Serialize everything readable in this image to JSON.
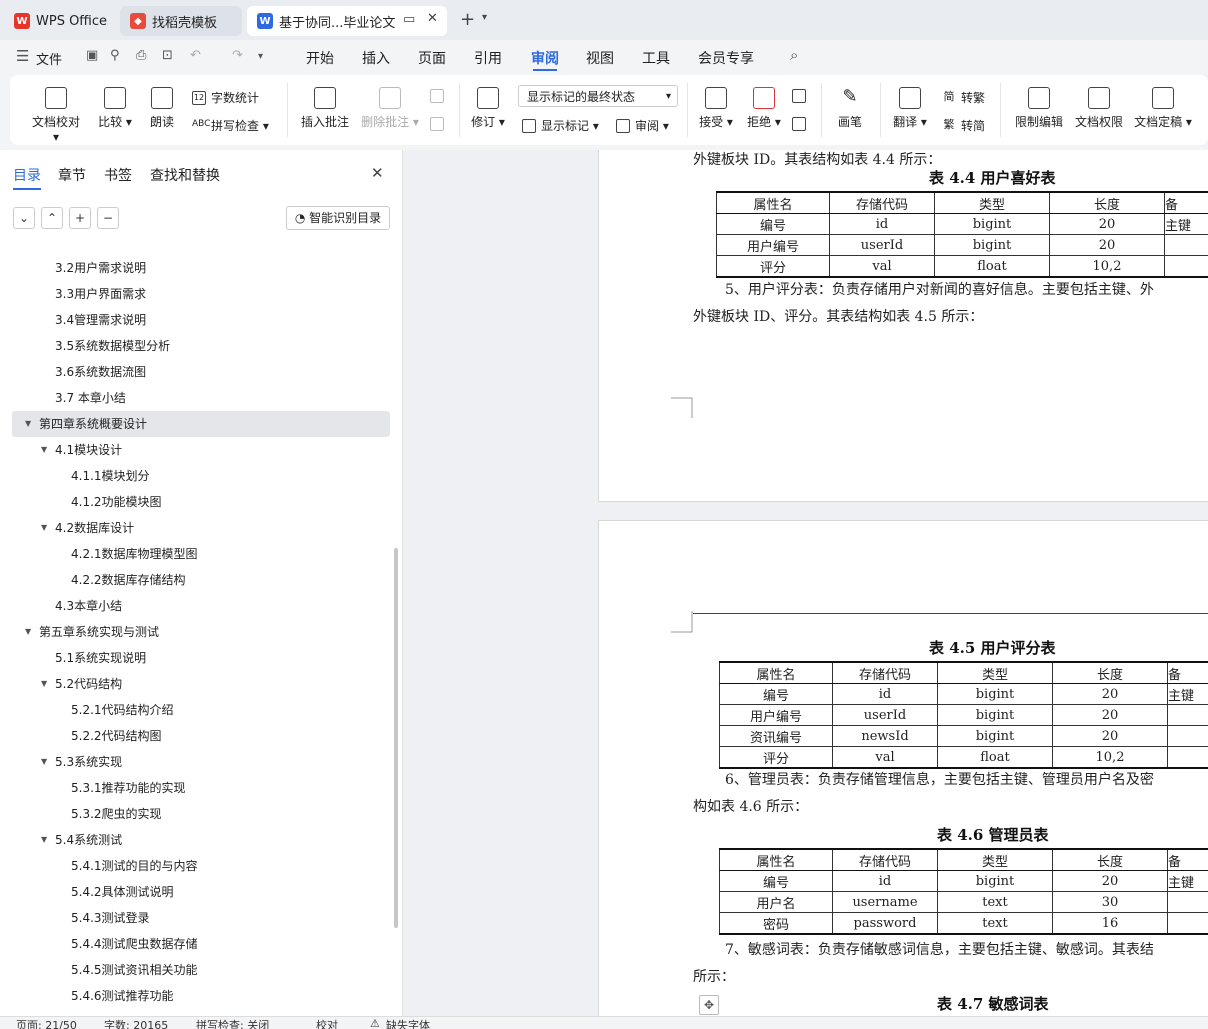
{
  "tabs": [
    {
      "label": "WPS Office"
    },
    {
      "label": "找稻壳模板"
    },
    {
      "label": "基于协同...毕业论文"
    }
  ],
  "menu": {
    "file": "文件",
    "items": [
      "开始",
      "插入",
      "页面",
      "引用",
      "审阅",
      "视图",
      "工具",
      "会员专享"
    ],
    "active": "审阅"
  },
  "ribbon": {
    "doc_check": "文档校对",
    "compare": "比较",
    "read_aloud": "朗读",
    "word_count": "字数统计",
    "spell_check": "拼写检查",
    "insert_comment": "插入批注",
    "delete_comment": "删除批注",
    "track_changes": "修订",
    "markup_state": "显示标记的最终状态",
    "show_markup": "显示标记",
    "review": "审阅",
    "accept": "接受",
    "reject": "拒绝",
    "pen": "画笔",
    "translate": "翻译",
    "to_traditional": "转繁",
    "to_simplified": "转简",
    "restrict_edit": "限制编辑",
    "doc_permission": "文档权限",
    "doc_finalize": "文档定稿"
  },
  "nav": {
    "tabs": [
      "目录",
      "章节",
      "书签",
      "查找和替换"
    ],
    "smart_toc": "智能识别目录",
    "toc": [
      {
        "text": "3.2用户需求说明",
        "level": 2
      },
      {
        "text": "3.3用户界面需求",
        "level": 2
      },
      {
        "text": "3.4管理需求说明",
        "level": 2
      },
      {
        "text": "3.5系统数据模型分析",
        "level": 2
      },
      {
        "text": "3.6系统数据流图",
        "level": 2
      },
      {
        "text": "3.7  本章小结",
        "level": 2
      },
      {
        "text": "第四章系统概要设计",
        "level": 1
      },
      {
        "text": "4.1模块设计",
        "level": 2
      },
      {
        "text": "4.1.1模块划分",
        "level": 3
      },
      {
        "text": "4.1.2功能模块图",
        "level": 3
      },
      {
        "text": "4.2数据库设计",
        "level": 2
      },
      {
        "text": "4.2.1数据库物理模型图",
        "level": 3
      },
      {
        "text": "4.2.2数据库存储结构",
        "level": 3
      },
      {
        "text": "4.3本章小结",
        "level": 2
      },
      {
        "text": "第五章系统实现与测试",
        "level": 1
      },
      {
        "text": "5.1系统实现说明",
        "level": 2
      },
      {
        "text": "5.2代码结构",
        "level": 2
      },
      {
        "text": "5.2.1代码结构介绍",
        "level": 3
      },
      {
        "text": "5.2.2代码结构图",
        "level": 3
      },
      {
        "text": "5.3系统实现",
        "level": 2
      },
      {
        "text": "5.3.1推荐功能的实现",
        "level": 3
      },
      {
        "text": "5.3.2爬虫的实现",
        "level": 3
      },
      {
        "text": "5.4系统测试",
        "level": 2
      },
      {
        "text": "5.4.1测试的目的与内容",
        "level": 3
      },
      {
        "text": "5.4.2具体测试说明",
        "level": 3
      },
      {
        "text": "5.4.3测试登录",
        "level": 3
      },
      {
        "text": "5.4.4测试爬虫数据存储",
        "level": 3
      },
      {
        "text": "5.4.5测试资讯相关功能",
        "level": 3
      },
      {
        "text": "5.4.6测试推荐功能",
        "level": 3
      }
    ]
  },
  "doc": {
    "p1": "外键板块 ID。其表结构如表 4.4 所示：",
    "cap44": "表 4.4 用户喜好表",
    "t44": {
      "header": [
        "属性名",
        "存储代码",
        "类型",
        "长度",
        "备"
      ],
      "rows": [
        [
          "编号",
          "id",
          "bigint",
          "20",
          "主键"
        ],
        [
          "用户编号",
          "userId",
          "bigint",
          "20",
          ""
        ],
        [
          "评分",
          "val",
          "float",
          "10,2",
          ""
        ]
      ]
    },
    "p2": "5、用户评分表：负责存储用户对新闻的喜好信息。主要包括主键、外",
    "p3": "外键板块 ID、评分。其表结构如表 4.5 所示：",
    "cap45": "表 4.5 用户评分表",
    "t45": {
      "header": [
        "属性名",
        "存储代码",
        "类型",
        "长度",
        "备"
      ],
      "rows": [
        [
          "编号",
          "id",
          "bigint",
          "20",
          "主键"
        ],
        [
          "用户编号",
          "userId",
          "bigint",
          "20",
          ""
        ],
        [
          "资讯编号",
          "newsId",
          "bigint",
          "20",
          ""
        ],
        [
          "评分",
          "val",
          "float",
          "10,2",
          ""
        ]
      ]
    },
    "p4": "6、管理员表：负责存储管理信息，主要包括主键、管理员用户名及密",
    "p5": "构如表 4.6 所示：",
    "cap46": "表 4.6 管理员表",
    "t46": {
      "header": [
        "属性名",
        "存储代码",
        "类型",
        "长度",
        "备"
      ],
      "rows": [
        [
          "编号",
          "id",
          "bigint",
          "20",
          "主键"
        ],
        [
          "用户名",
          "username",
          "text",
          "30",
          ""
        ],
        [
          "密码",
          "password",
          "text",
          "16",
          ""
        ]
      ]
    },
    "p6": "7、敏感词表：负责存储敏感词信息，主要包括主键、敏感词。其表结",
    "p7": "所示：",
    "cap47": "表 4.7 敏感词表"
  },
  "status": {
    "page": "页面: 21/50",
    "words": "字数: 20165",
    "spell": "拼写检查: 关闭",
    "proof": "校对",
    "missing_font": "缺失字体"
  },
  "colors": {
    "accent": "#2f6ae0",
    "wps_red": "#e8352b"
  }
}
